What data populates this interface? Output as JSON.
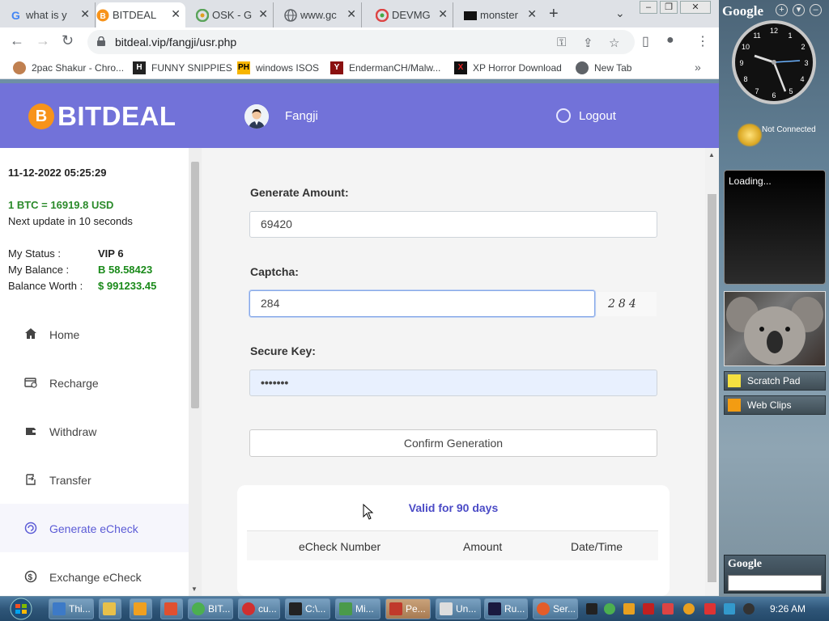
{
  "tabs": [
    {
      "title": "what is y",
      "icon": "google-icon"
    },
    {
      "title": "BITDEAL",
      "icon": "bitcoin-icon"
    },
    {
      "title": "OSK - G",
      "icon": "chrome-icon"
    },
    {
      "title": "www.gc",
      "icon": "globe-icon"
    },
    {
      "title": "DEVMG",
      "icon": "chrome-icon"
    },
    {
      "title": "monster",
      "icon": "terminal-icon"
    }
  ],
  "address_bar": {
    "url": "bitdeal.vip/fangji/usr.php"
  },
  "bookmarks": [
    {
      "label": "2pac Shakur - Chro..."
    },
    {
      "label": "FUNNY SNIPPIES",
      "badge": "H"
    },
    {
      "label": "windows ISOS",
      "badge": "PH"
    },
    {
      "label": "EndermanCH/Malw...",
      "badge": "Y"
    },
    {
      "label": "XP Horror Download",
      "badge": "X"
    },
    {
      "label": "New Tab"
    }
  ],
  "brand": {
    "name": "BITDEAL",
    "coin_glyph": "B"
  },
  "header": {
    "username": "Fangji",
    "logout_label": "Logout"
  },
  "sidebar": {
    "datetime": "11-12-2022 05:25:29",
    "rate": "1 BTC = 16919.8 USD",
    "next_update": "Next update in 10 seconds",
    "status_label": "My Status :",
    "status_value": "VIP 6",
    "balance_label": "My Balance :",
    "balance_value": "B 58.58423",
    "worth_label": "Balance Worth :",
    "worth_value": "$ 991233.45",
    "menu": [
      {
        "label": "Home",
        "icon": "home-icon"
      },
      {
        "label": "Recharge",
        "icon": "recharge-icon"
      },
      {
        "label": "Withdraw",
        "icon": "wallet-icon"
      },
      {
        "label": "Transfer",
        "icon": "transfer-icon"
      },
      {
        "label": "Generate eCheck",
        "icon": "generate-icon"
      },
      {
        "label": "Exchange eCheck",
        "icon": "exchange-icon"
      }
    ]
  },
  "form": {
    "amount_label": "Generate Amount:",
    "amount_value": "69420",
    "captcha_label": "Captcha:",
    "captcha_value": "284",
    "captcha_image_text": "284",
    "securekey_label": "Secure Key:",
    "securekey_value": "•••••••",
    "confirm_label": "Confirm Generation"
  },
  "table": {
    "valid_text": "Valid for 90 days",
    "headers": [
      "eCheck Number",
      "Amount",
      "Date/Time"
    ]
  },
  "gadgets": {
    "google_label": "Google",
    "clock_status": "Not Connected",
    "feed_status": "Loading...",
    "scratch_pad": "Scratch Pad",
    "web_clips": "Web Clips",
    "search_label": "Google"
  },
  "taskbar": {
    "items": [
      {
        "label": "Thi...",
        "color": "#3d7ac7"
      },
      {
        "label": "",
        "color": "#e8c04a"
      },
      {
        "label": "",
        "color": "#f0a020"
      },
      {
        "label": "",
        "color": "#e05030"
      },
      {
        "label": "BIT...",
        "color": "#4caf50"
      },
      {
        "label": "cu...",
        "color": "#d03030"
      },
      {
        "label": "C:\\...",
        "color": "#222222"
      },
      {
        "label": "Mi...",
        "color": "#4a9a4a"
      },
      {
        "label": "Pe...",
        "color": "#c0392b"
      },
      {
        "label": "Un...",
        "color": "#dddddd"
      },
      {
        "label": "Ru...",
        "color": "#1a1a40"
      },
      {
        "label": "Ser...",
        "color": "#e35d2a"
      }
    ],
    "time": "9:26 AM"
  }
}
